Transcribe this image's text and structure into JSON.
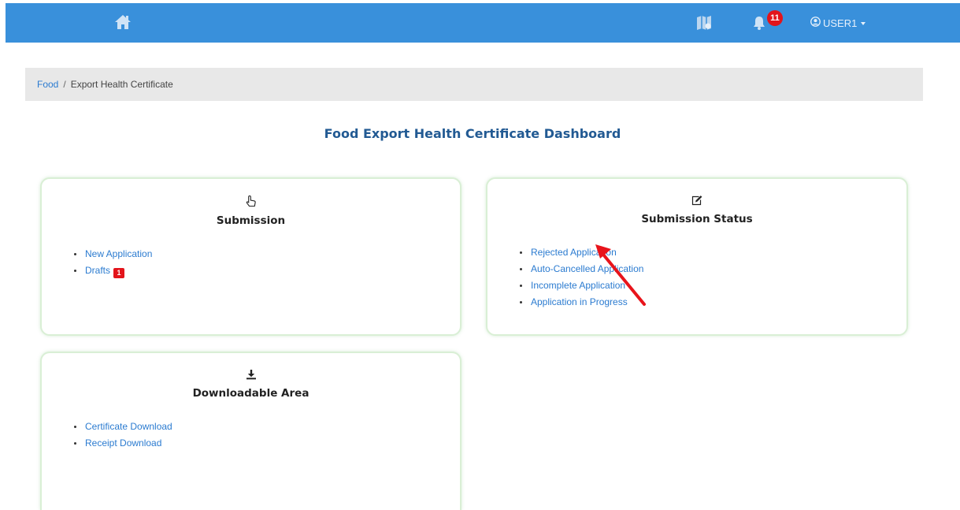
{
  "navbar": {
    "home_icon": "home-icon",
    "map_icon": "map-icon",
    "bell_icon": "bell-icon",
    "notification_count": "11",
    "user_icon": "user-circle-icon",
    "user_label": "USER1",
    "colors": {
      "bar": "#3990db",
      "badge": "#e3141b"
    }
  },
  "breadcrumb": {
    "root": "Food",
    "separator": "/",
    "current": "Export Health Certificate"
  },
  "page": {
    "title": "Food Export Health Certificate Dashboard"
  },
  "cards": {
    "submission": {
      "icon": "hand-pointer-icon",
      "title": "Submission",
      "items": [
        {
          "label": "New Application"
        },
        {
          "label": "Drafts",
          "badge": "1"
        }
      ]
    },
    "status": {
      "icon": "edit-icon",
      "title": "Submission Status",
      "items": [
        {
          "label": "Rejected Application"
        },
        {
          "label": "Auto-Cancelled Application"
        },
        {
          "label": "Incomplete Application"
        },
        {
          "label": "Application in Progress"
        }
      ]
    },
    "downloads": {
      "icon": "download-icon",
      "title": "Downloadable Area",
      "items": [
        {
          "label": "Certificate Download"
        },
        {
          "label": "Receipt Download"
        }
      ]
    }
  },
  "annotation": {
    "icon": "red-arrow-icon",
    "color": "#e8141b"
  }
}
